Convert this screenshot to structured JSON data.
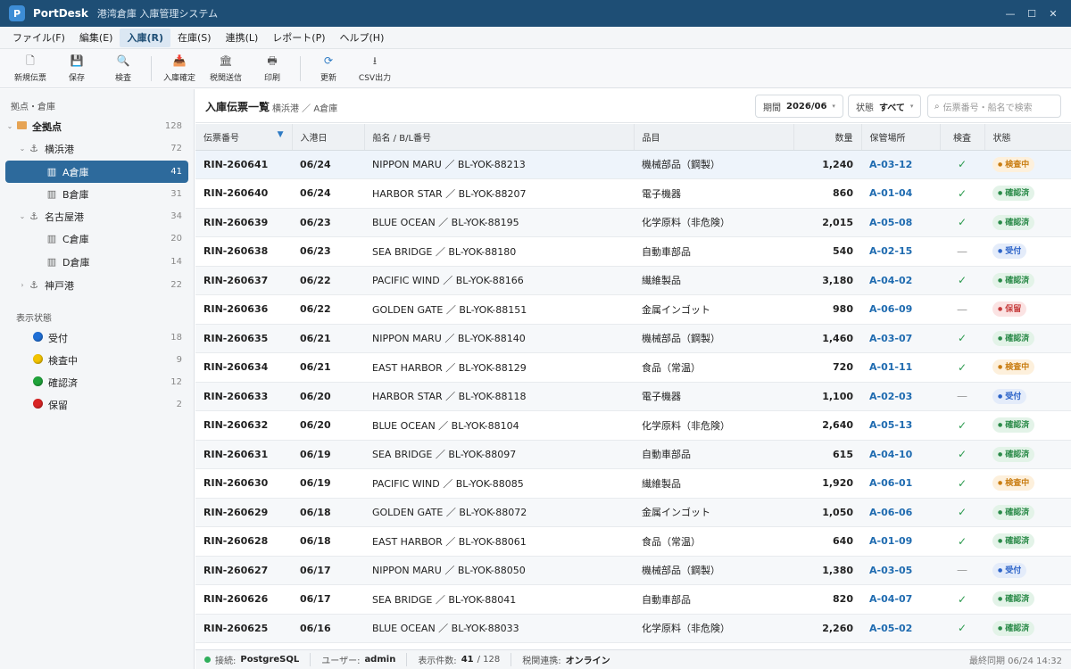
{
  "window": {
    "app_name": "PortDesk",
    "app_subtitle": "港湾倉庫 入庫管理システム",
    "app_icon_letter": "P",
    "controls": {
      "minimize": "—",
      "maximize": "☐",
      "close": "✕"
    }
  },
  "menu": [
    {
      "label": "ファイル(F)"
    },
    {
      "label": "編集(E)"
    },
    {
      "label": "入庫(R)",
      "active": true
    },
    {
      "label": "在庫(S)"
    },
    {
      "label": "連携(L)"
    },
    {
      "label": "レポート(P)"
    },
    {
      "label": "ヘルプ(H)"
    }
  ],
  "toolbar": {
    "new_label": "新規伝票",
    "save_label": "保存",
    "search_label": "検査",
    "confirm_label": "入庫確定",
    "customs_label": "税関送信",
    "print_label": "印刷",
    "refresh_label": "更新",
    "csv_label": "CSV出力"
  },
  "sidebar": {
    "section_title": "拠点・倉庫",
    "tree": [
      {
        "label": "全拠点",
        "count": "128"
      },
      {
        "label": "横浜港",
        "count": "72"
      },
      {
        "label": "A倉庫",
        "count": "41",
        "selected": true
      },
      {
        "label": "B倉庫",
        "count": "31"
      },
      {
        "label": "名古屋港",
        "count": "34"
      },
      {
        "label": "C倉庫",
        "count": "20"
      },
      {
        "label": "D倉庫",
        "count": "14"
      },
      {
        "label": "神戸港",
        "count": "22"
      }
    ],
    "status_title": "表示状態",
    "statuses": [
      {
        "label": "受付",
        "count": "18",
        "color": "#1f6fd6"
      },
      {
        "label": "検査中",
        "count": "9",
        "color": "#f2c300"
      },
      {
        "label": "確認済",
        "count": "12",
        "color": "#1fa33a"
      },
      {
        "label": "保留",
        "count": "2",
        "color": "#d92525"
      }
    ]
  },
  "main": {
    "title": "入庫伝票一覧",
    "breadcrumb": "横浜港 ／ A倉庫",
    "period_label": "期間",
    "period_value": "2026/06",
    "status_label": "状態",
    "status_value": "すべて",
    "search_placeholder": "伝票番号・船名で検索"
  },
  "table": {
    "columns": [
      "伝票番号",
      "入港日",
      "船名 / B/L番号",
      "品目",
      "数量",
      "保管場所",
      "検査",
      "状態"
    ],
    "rows": [
      {
        "id": "RIN-260641",
        "date": "06/24",
        "vessel": "NIPPON MARU ／ BL-YOK-88213",
        "item": "機械部品（鋼製）",
        "qty": "1,240",
        "loc": "A-03-12",
        "check": "✓",
        "status": "検査中",
        "tone": "orange"
      },
      {
        "id": "RIN-260640",
        "date": "06/24",
        "vessel": "HARBOR STAR ／ BL-YOK-88207",
        "item": "電子機器",
        "qty": "860",
        "loc": "A-01-04",
        "check": "✓",
        "status": "確認済",
        "tone": "green"
      },
      {
        "id": "RIN-260639",
        "date": "06/23",
        "vessel": "BLUE OCEAN ／ BL-YOK-88195",
        "item": "化学原料（非危険）",
        "qty": "2,015",
        "loc": "A-05-08",
        "check": "✓",
        "status": "確認済",
        "tone": "green"
      },
      {
        "id": "RIN-260638",
        "date": "06/23",
        "vessel": "SEA BRIDGE ／ BL-YOK-88180",
        "item": "自動車部品",
        "qty": "540",
        "loc": "A-02-15",
        "check": "—",
        "status": "受付",
        "tone": "blue"
      },
      {
        "id": "RIN-260637",
        "date": "06/22",
        "vessel": "PACIFIC WIND ／ BL-YOK-88166",
        "item": "繊維製品",
        "qty": "3,180",
        "loc": "A-04-02",
        "check": "✓",
        "status": "確認済",
        "tone": "green"
      },
      {
        "id": "RIN-260636",
        "date": "06/22",
        "vessel": "GOLDEN GATE ／ BL-YOK-88151",
        "item": "金属インゴット",
        "qty": "980",
        "loc": "A-06-09",
        "check": "—",
        "status": "保留",
        "tone": "red"
      },
      {
        "id": "RIN-260635",
        "date": "06/21",
        "vessel": "NIPPON MARU ／ BL-YOK-88140",
        "item": "機械部品（鋼製）",
        "qty": "1,460",
        "loc": "A-03-07",
        "check": "✓",
        "status": "確認済",
        "tone": "green"
      },
      {
        "id": "RIN-260634",
        "date": "06/21",
        "vessel": "EAST HARBOR ／ BL-YOK-88129",
        "item": "食品（常温）",
        "qty": "720",
        "loc": "A-01-11",
        "check": "✓",
        "status": "検査中",
        "tone": "orange"
      },
      {
        "id": "RIN-260633",
        "date": "06/20",
        "vessel": "HARBOR STAR ／ BL-YOK-88118",
        "item": "電子機器",
        "qty": "1,100",
        "loc": "A-02-03",
        "check": "—",
        "status": "受付",
        "tone": "blue"
      },
      {
        "id": "RIN-260632",
        "date": "06/20",
        "vessel": "BLUE OCEAN ／ BL-YOK-88104",
        "item": "化学原料（非危険）",
        "qty": "2,640",
        "loc": "A-05-13",
        "check": "✓",
        "status": "確認済",
        "tone": "green"
      },
      {
        "id": "RIN-260631",
        "date": "06/19",
        "vessel": "SEA BRIDGE ／ BL-YOK-88097",
        "item": "自動車部品",
        "qty": "615",
        "loc": "A-04-10",
        "check": "✓",
        "status": "確認済",
        "tone": "green"
      },
      {
        "id": "RIN-260630",
        "date": "06/19",
        "vessel": "PACIFIC WIND ／ BL-YOK-88085",
        "item": "繊維製品",
        "qty": "1,920",
        "loc": "A-06-01",
        "check": "✓",
        "status": "検査中",
        "tone": "orange"
      },
      {
        "id": "RIN-260629",
        "date": "06/18",
        "vessel": "GOLDEN GATE ／ BL-YOK-88072",
        "item": "金属インゴット",
        "qty": "1,050",
        "loc": "A-06-06",
        "check": "✓",
        "status": "確認済",
        "tone": "green"
      },
      {
        "id": "RIN-260628",
        "date": "06/18",
        "vessel": "EAST HARBOR ／ BL-YOK-88061",
        "item": "食品（常温）",
        "qty": "640",
        "loc": "A-01-09",
        "check": "✓",
        "status": "確認済",
        "tone": "green"
      },
      {
        "id": "RIN-260627",
        "date": "06/17",
        "vessel": "NIPPON MARU ／ BL-YOK-88050",
        "item": "機械部品（鋼製）",
        "qty": "1,380",
        "loc": "A-03-05",
        "check": "—",
        "status": "受付",
        "tone": "blue"
      },
      {
        "id": "RIN-260626",
        "date": "06/17",
        "vessel": "SEA BRIDGE ／ BL-YOK-88041",
        "item": "自動車部品",
        "qty": "820",
        "loc": "A-04-07",
        "check": "✓",
        "status": "確認済",
        "tone": "green"
      },
      {
        "id": "RIN-260625",
        "date": "06/16",
        "vessel": "BLUE OCEAN ／ BL-YOK-88033",
        "item": "化学原料（非危険）",
        "qty": "2,260",
        "loc": "A-05-02",
        "check": "✓",
        "status": "確認済",
        "tone": "green"
      }
    ]
  },
  "statusbar": {
    "conn_label": "接続:",
    "conn_value": "PostgreSQL",
    "user_label": "ユーザー:",
    "user_value": "admin",
    "count_label": "表示件数:",
    "count_value": "41",
    "count_total": "/ 128",
    "customs_label": "税関連携:",
    "customs_value": "オンライン",
    "last_sync": "最終同期 06/24 14:32"
  }
}
